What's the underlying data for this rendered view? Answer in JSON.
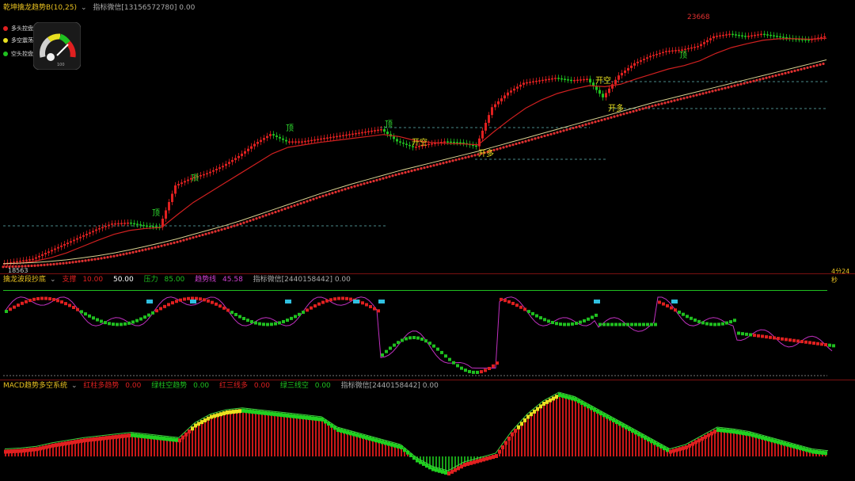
{
  "top_bar": {
    "text": ""
  },
  "main": {
    "indicator_name": "乾坤擒龙趋势B(10,25)",
    "indicator_extra": "指标微信[13156572780] 0.00",
    "legend": [
      {
        "label": "多头控盘",
        "color": "#e02020"
      },
      {
        "label": "多空震荡",
        "color": "#e8e020"
      },
      {
        "label": "空头控盘",
        "color": "#20c020"
      }
    ],
    "gauge_label": "100",
    "high_label": "23668",
    "low_label": "18563",
    "time_label": "4分24秒",
    "signals": [
      {
        "text": "顶",
        "x": 192,
        "y": 272
      },
      {
        "text": "顶",
        "x": 241,
        "y": 228
      },
      {
        "text": "顶",
        "x": 361,
        "y": 165
      },
      {
        "text": "顶",
        "x": 486,
        "y": 160
      },
      {
        "text": "开空",
        "x": 520,
        "y": 183
      },
      {
        "text": "开多",
        "x": 604,
        "y": 197
      },
      {
        "text": "开空",
        "x": 752,
        "y": 105
      },
      {
        "text": "开多",
        "x": 768,
        "y": 140
      },
      {
        "text": "顶",
        "x": 858,
        "y": 73
      }
    ]
  },
  "sub1": {
    "indicator_name": "擒龙波段抄底",
    "items": [
      {
        "label": "支撑",
        "value": "10.00",
        "color": "#e02020"
      },
      {
        "label": "",
        "value": "50.00",
        "color": "#ffffff"
      },
      {
        "label": "压力",
        "value": "85.00",
        "color": "#20c020"
      },
      {
        "label": "趋势线",
        "value": "45.58",
        "color": "#d040d0"
      }
    ],
    "extra": "指标微信[2440158442] 0.00"
  },
  "sub2": {
    "indicator_name": "MACD趋势多空系统",
    "items": [
      {
        "label": "红柱多趋势",
        "value": "0.00",
        "color": "#e02020"
      },
      {
        "label": "绿柱空趋势",
        "value": "0.00",
        "color": "#20c020"
      },
      {
        "label": "红三线多",
        "value": "0.00",
        "color": "#e02020"
      },
      {
        "label": "绿三线空",
        "value": "0.00",
        "color": "#20c020"
      }
    ],
    "extra": "指标微信[2440158442] 0.00"
  },
  "chart_data": {
    "type": "line",
    "title": "乾坤擒龙趋势B(10,25)",
    "y_range": [
      18563,
      23668
    ],
    "x": [
      0,
      20,
      40,
      60,
      80,
      100,
      120,
      140,
      160,
      180,
      200,
      220,
      240,
      260,
      280,
      300,
      320,
      340,
      360,
      380,
      400,
      420,
      440,
      460,
      480,
      500,
      520,
      540,
      560,
      580,
      600,
      620,
      640,
      660,
      680,
      700,
      720,
      740,
      760,
      780,
      800,
      820,
      840,
      860,
      880,
      900,
      920,
      940,
      960,
      980,
      1000,
      1020,
      1040
    ],
    "series": [
      {
        "values": [
          18600,
          18650,
          18700,
          18850,
          19000,
          19150,
          19300,
          19420,
          19440,
          19380,
          19350,
          20200,
          20350,
          20450,
          20600,
          20800,
          21050,
          21250,
          21100,
          21100,
          21150,
          21200,
          21250,
          21300,
          21350,
          21100,
          20980,
          21050,
          21100,
          21080,
          21000,
          21800,
          22100,
          22300,
          22350,
          22400,
          22350,
          22380,
          22000,
          22450,
          22700,
          22850,
          22950,
          22980,
          23050,
          23250,
          23300,
          23250,
          23300,
          23250,
          23200,
          23180,
          23250
        ]
      },
      {
        "values": [
          18590,
          18610,
          18650,
          18720,
          18820,
          18950,
          19080,
          19200,
          19280,
          19320,
          19340,
          19600,
          19850,
          20050,
          20250,
          20450,
          20650,
          20850,
          20980,
          21030,
          21080,
          21120,
          21160,
          21200,
          21240,
          21200,
          21120,
          21080,
          21060,
          21050,
          21030,
          21300,
          21550,
          21780,
          21950,
          22080,
          22170,
          22240,
          22220,
          22270,
          22380,
          22480,
          22580,
          22650,
          22750,
          22900,
          23020,
          23100,
          23170,
          23200,
          23200,
          23190,
          23210
        ]
      },
      {
        "values": [
          18550,
          18560,
          18575,
          18600,
          18630,
          18670,
          18715,
          18770,
          18835,
          18905,
          18980,
          19060,
          19150,
          19240,
          19330,
          19430,
          19540,
          19650,
          19760,
          19870,
          19980,
          20080,
          20180,
          20270,
          20360,
          20450,
          20530,
          20610,
          20690,
          20770,
          20850,
          20940,
          21030,
          21120,
          21210,
          21300,
          21390,
          21480,
          21570,
          21660,
          21750,
          21840,
          21920,
          22000,
          22080,
          22160,
          22240,
          22320,
          22400,
          22480,
          22560,
          22640,
          22720
        ]
      }
    ],
    "sub1_levels": [
      10,
      50,
      85
    ],
    "sub1_trend_value": 45.58,
    "sub2_histogram": [
      5,
      6,
      8,
      12,
      15,
      18,
      20,
      22,
      24,
      22,
      20,
      18,
      35,
      45,
      50,
      52,
      50,
      48,
      46,
      44,
      42,
      30,
      25,
      20,
      15,
      10,
      -5,
      -15,
      -20,
      -10,
      -5,
      0,
      25,
      45,
      60,
      70,
      65,
      55,
      45,
      35,
      25,
      15,
      5,
      10,
      20,
      30,
      28,
      25,
      20,
      15,
      10,
      5,
      3
    ]
  }
}
